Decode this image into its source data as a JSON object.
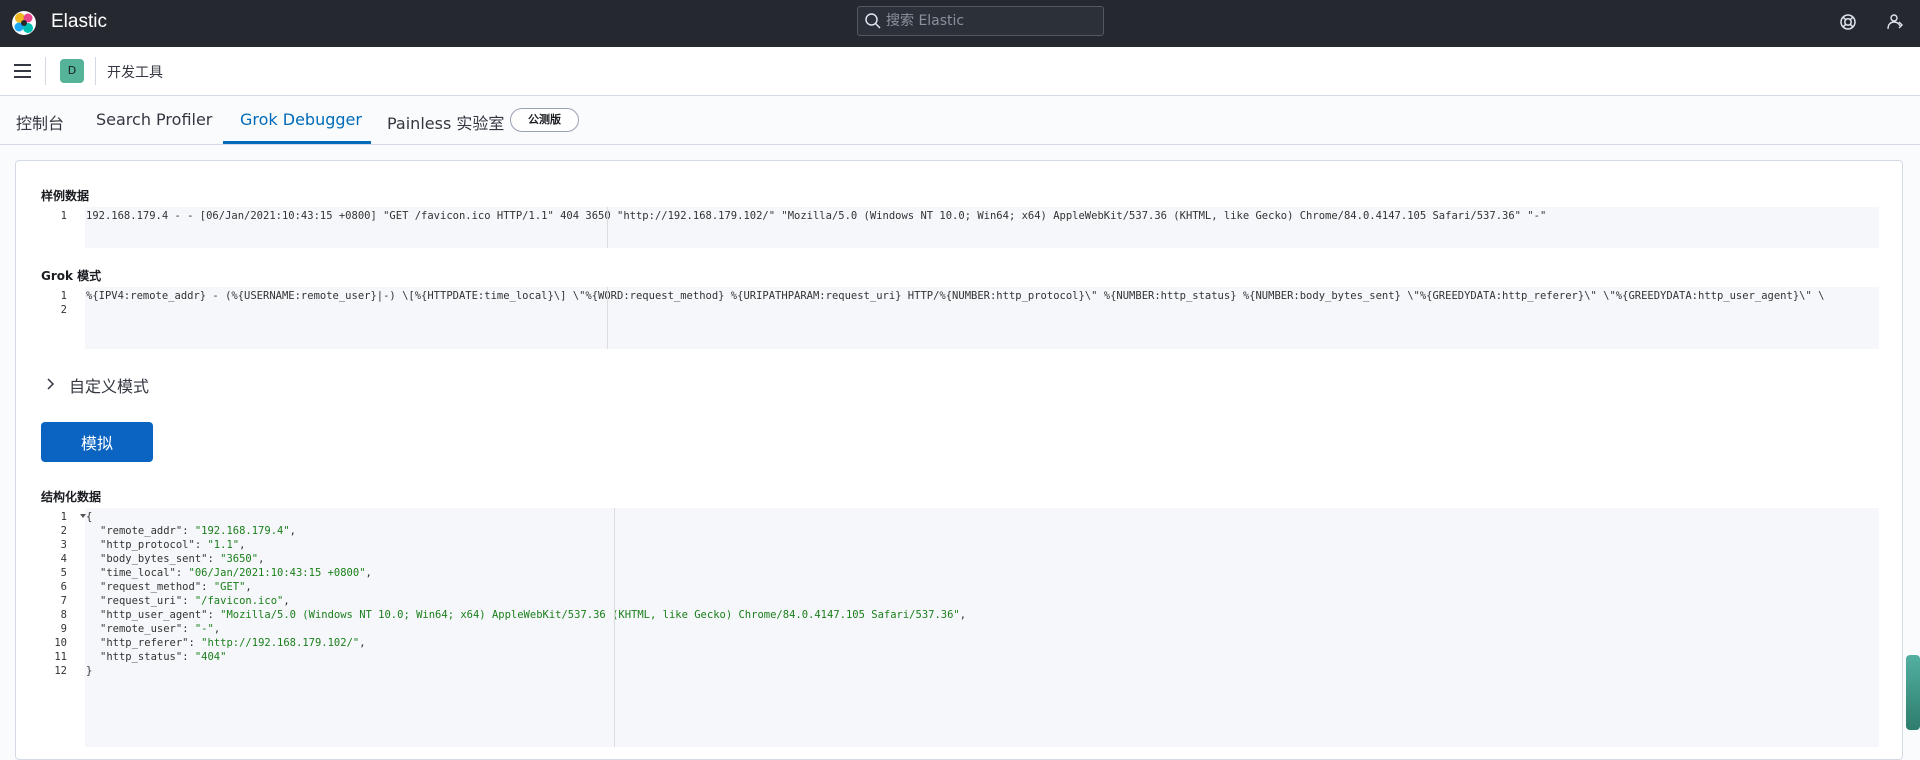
{
  "header": {
    "brand": "Elastic",
    "search_placeholder": "搜索 Elastic",
    "icons": [
      "elastic-logo-icon",
      "help-icon",
      "user-menu-icon"
    ]
  },
  "subbar": {
    "space_initial": "D",
    "breadcrumb": "开发工具"
  },
  "tabs": [
    {
      "label": "控制台"
    },
    {
      "label": "Search Profiler"
    },
    {
      "label": "Grok Debugger"
    },
    {
      "label": "Painless 实验室"
    }
  ],
  "beta_badge": "公测版",
  "active_tab": "Grok Debugger",
  "sample": {
    "label": "样例数据",
    "lines": [
      "192.168.179.4 - - [06/Jan/2021:10:43:15 +0800] \"GET /favicon.ico HTTP/1.1\" 404 3650 \"http://192.168.179.102/\" \"Mozilla/5.0 (Windows NT 10.0; Win64; x64) AppleWebKit/537.36 (KHTML, like Gecko) Chrome/84.0.4147.105 Safari/537.36\" \"-\""
    ]
  },
  "grok": {
    "label": "Grok 模式",
    "lines": [
      "%{IPV4:remote_addr} - (%{USERNAME:remote_user}|-) \\[%{HTTPDATE:time_local}\\] \\\"%{WORD:request_method} %{URIPATHPARAM:request_uri} HTTP/%{NUMBER:http_protocol}\\\" %{NUMBER:http_status} %{NUMBER:body_bytes_sent} \\\"%{GREEDYDATA:http_referer}\\\" \\\"%{GREEDYDATA:http_user_agent}\\\" \\",
      ""
    ]
  },
  "custom_patterns": "自定义模式",
  "simulate_button": "模拟",
  "structured": {
    "label": "结构化数据",
    "open": "{",
    "close": "}",
    "fields": [
      {
        "key": "\"remote_addr\"",
        "value": "\"192.168.179.4\""
      },
      {
        "key": "\"http_protocol\"",
        "value": "\"1.1\""
      },
      {
        "key": "\"body_bytes_sent\"",
        "value": "\"3650\""
      },
      {
        "key": "\"time_local\"",
        "value": "\"06/Jan/2021:10:43:15 +0800\""
      },
      {
        "key": "\"request_method\"",
        "value": "\"GET\""
      },
      {
        "key": "\"request_uri\"",
        "value": "\"/favicon.ico\""
      },
      {
        "key": "\"http_user_agent\"",
        "value": "\"Mozilla/5.0 (Windows NT 10.0; Win64; x64) AppleWebKit/537.36 (KHTML, like Gecko) Chrome/84.0.4147.105 Safari/537.36\""
      },
      {
        "key": "\"remote_user\"",
        "value": "\"-\""
      },
      {
        "key": "\"http_referer\"",
        "value": "\"http://192.168.179.102/\""
      },
      {
        "key": "\"http_status\"",
        "value": "\"404\""
      }
    ]
  },
  "colors": {
    "header_bg": "#25282f",
    "accent": "#006bb8",
    "button": "#0b64c1",
    "space_badge": "#54b399",
    "json_string": "#1a7f1a"
  }
}
